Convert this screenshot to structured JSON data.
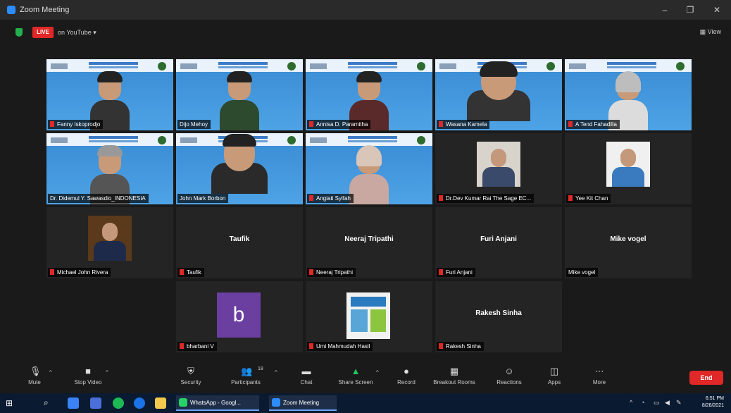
{
  "window": {
    "title": "Zoom Meeting",
    "minimize": "–",
    "restore": "❐",
    "close": "✕"
  },
  "topbar": {
    "live_badge": "LIVE",
    "streaming_label": "on YouTube ▾",
    "view_label": "▦ View"
  },
  "participants": [
    {
      "name": "Fanny Iskoprodjo",
      "type": "video"
    },
    {
      "name": "Dijo Mehoy",
      "type": "video"
    },
    {
      "name": "Annisa D. Paramitha",
      "type": "video"
    },
    {
      "name": "Wasana Kamela",
      "type": "video"
    },
    {
      "name": "A Tend Fahadilla",
      "type": "video"
    },
    {
      "name": "Dr. Didemul Y. Sawasdio_INDONESIA",
      "type": "video"
    },
    {
      "name": "John Mark Borbon",
      "type": "video",
      "active_speaker": true
    },
    {
      "name": "Angiati Syifah",
      "type": "video"
    },
    {
      "name": "Dr.Dev Kumar Rai The Sage EC...",
      "type": "photo"
    },
    {
      "name": "Yee Kit Chan",
      "type": "photo"
    },
    {
      "name": "Michael John Rivera",
      "type": "photo"
    },
    {
      "name": "Taufik",
      "type": "name"
    },
    {
      "name": "Neeraj Tripathi",
      "type": "name"
    },
    {
      "name": "Furi Anjani",
      "type": "name"
    },
    {
      "name": "Mike vogel",
      "type": "name"
    },
    {
      "name": "bharbani V",
      "type": "avatar",
      "avatar_letter": "b"
    },
    {
      "name": "Umi Mahmudah Hasil",
      "type": "poster"
    },
    {
      "name": "Rakesh Sinha",
      "type": "name"
    }
  ],
  "toolbar": {
    "mute": "Mute",
    "stop_video": "Stop Video",
    "security": "Security",
    "participants": "Participants",
    "participants_count": "18",
    "chat": "Chat",
    "share_screen": "Share Screen",
    "record": "Record",
    "breakout_rooms": "Breakout Rooms",
    "reactions": "Reactions",
    "apps": "Apps",
    "more": "More",
    "end": "End"
  },
  "taskbar": {
    "whatsapp": "WhatsApp - Googl...",
    "zoom": "Zoom Meeting",
    "time": "6:51 PM",
    "date": "8/28/2021"
  },
  "colors": {
    "live_red": "#e02828",
    "end_red": "#e02828",
    "active_speaker_border": "#c7e34a",
    "share_green": "#22c55e",
    "avatar_purple": "#6b3fa0"
  }
}
